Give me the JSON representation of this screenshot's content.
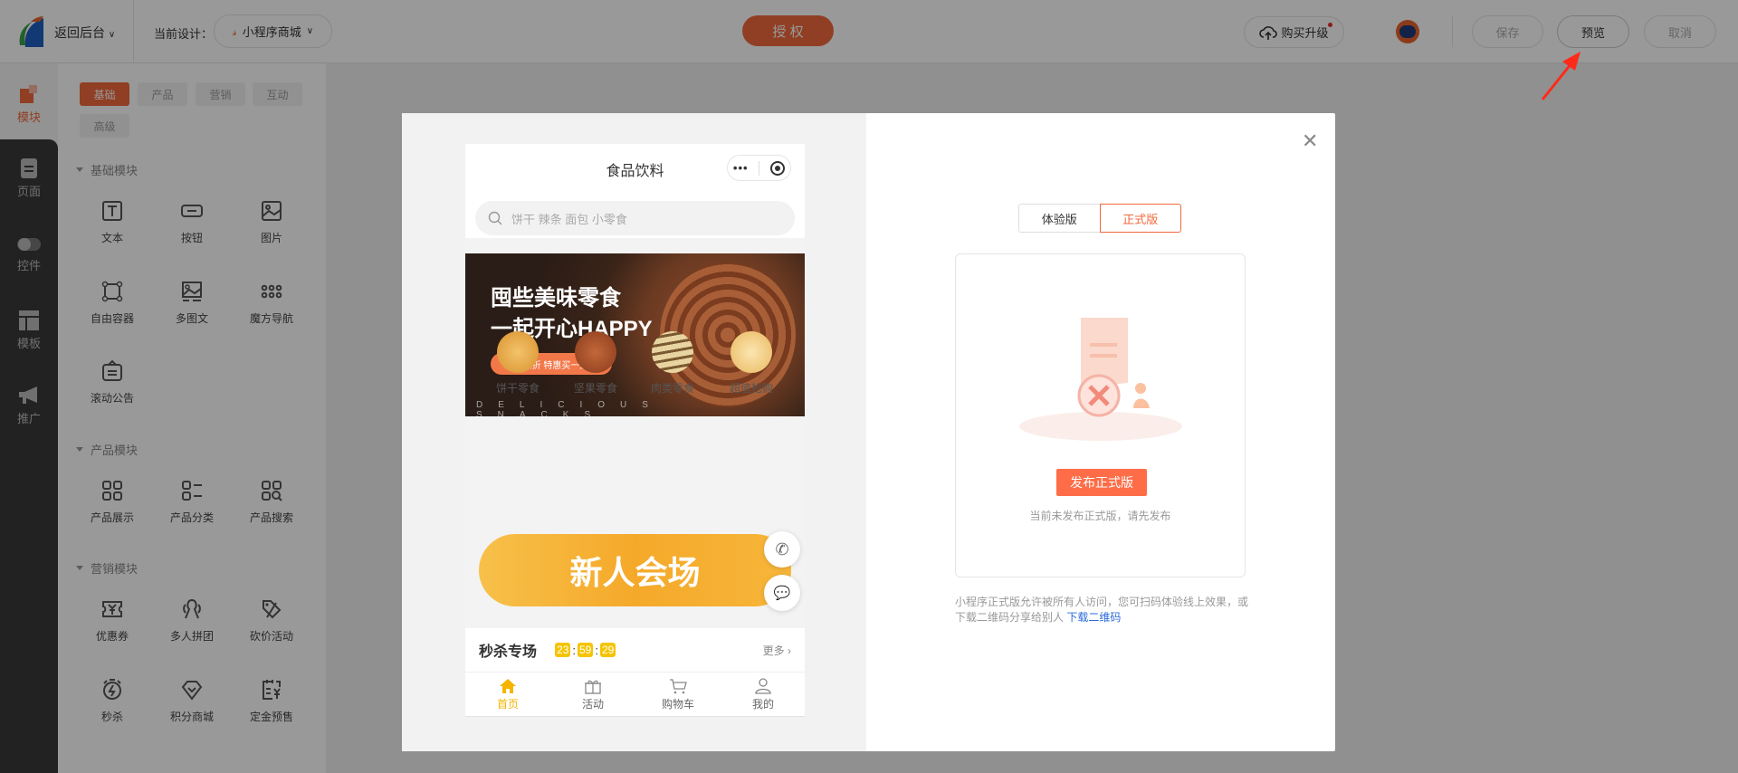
{
  "topbar": {
    "back_label": "返回后台",
    "design_label": "当前设计：",
    "design_name": "小程序商城",
    "authorize": "授 权",
    "upgrade": "购买升级",
    "save": "保存",
    "preview": "预览",
    "cancel": "取消"
  },
  "rail": [
    {
      "label": "模块",
      "icon": "module-icon"
    },
    {
      "label": "页面",
      "icon": "page-icon"
    },
    {
      "label": "控件",
      "icon": "toggle-icon"
    },
    {
      "label": "模板",
      "icon": "template-icon"
    },
    {
      "label": "推广",
      "icon": "megaphone-icon"
    }
  ],
  "panel": {
    "tabs": [
      "基础",
      "产品",
      "营销",
      "互动",
      "高级"
    ],
    "sections": [
      {
        "title": "基础模块",
        "items": [
          "文本",
          "按钮",
          "图片",
          "自由容器",
          "多图文",
          "魔方导航",
          "滚动公告"
        ]
      },
      {
        "title": "产品模块",
        "items": [
          "产品展示",
          "产品分类",
          "产品搜索"
        ]
      },
      {
        "title": "营销模块",
        "items": [
          "优惠券",
          "多人拼团",
          "砍价活动",
          "秒杀",
          "积分商城",
          "定金预售"
        ]
      }
    ]
  },
  "phone": {
    "title": "食品饮料",
    "search_placeholder": "饼干 辣条 面包 小零食",
    "banner": {
      "line1": "囤些美味零食",
      "line2": "一起开心HAPPY",
      "button": "全场五折 特惠买一送一",
      "footer": "DELICIOUS SNACKS"
    },
    "categories": [
      "饼干零食",
      "坚果零食",
      "肉类零食",
      "超值抢购"
    ],
    "promo": "新人会场",
    "flash": {
      "title": "秒杀专场",
      "h": "23",
      "m": "59",
      "s": "29",
      "more": "更多"
    },
    "tabbar": [
      "首页",
      "活动",
      "购物车",
      "我的"
    ],
    "accent": "#f5b400"
  },
  "release": {
    "tabs": [
      "体验版",
      "正式版"
    ],
    "publish_button": "发布正式版",
    "hint": "当前未发布正式版，请先发布",
    "desc": "小程序正式版允许被所有人访问，您可扫码体验线上效果，或下载二维码分享给别人 ",
    "download_link": "下载二维码"
  },
  "colors": {
    "brand": "#f06a3c",
    "annotation_arrow": "#ff2a1a",
    "link": "#2a6bd8"
  }
}
